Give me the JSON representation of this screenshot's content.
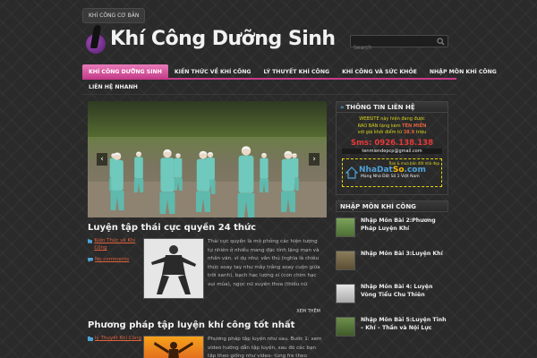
{
  "topbar": {
    "tab_label": "KHÍ CÔNG CƠ BẢN"
  },
  "site": {
    "title": "Khí Công Dưỡng Sinh"
  },
  "search": {
    "placeholder": "Search"
  },
  "nav": {
    "items": [
      {
        "label": "KHÍ CÔNG DƯỠNG SINH"
      },
      {
        "label": "KIẾN THỨC VỀ KHÍ CÔNG"
      },
      {
        "label": "LÝ THUYẾT KHÍ CÔNG"
      },
      {
        "label": "KHÍ CÔNG VÀ SỨC KHỎE"
      },
      {
        "label": "NHẬP MÔN KHÍ CÔNG"
      }
    ],
    "row2": [
      {
        "label": "LIÊN HỆ NHANH"
      }
    ]
  },
  "slider": {
    "prev": "‹",
    "next": "›"
  },
  "posts": [
    {
      "title": "Luyện tập thái cực quyền 24 thức",
      "category": "Kiến Thức về Khí Công",
      "comments": "No comments",
      "excerpt": "Thái cực quyền là mô phỏng các hiện tượng tự nhiên ở nhiều mang đặc tính lặng mạn và nhân văn, ví dụ như: vân thủ (nghĩa là chiêu thức xoay tay như mây trắng xoay cuộn giữa trời xanh), bạch hạc lượng xí (con chim hạc vui múa), ngọc nữ xuyên thoa (thiếu nữ",
      "read_more": "XEM THÊM"
    },
    {
      "title": "Phương pháp tập luyện khí công tốt nhất",
      "category": "lý Thuyết Khí Công",
      "excerpt": "Phương pháp tập luyện như sau. Bước 1: xem video hướng dẫn tập luyện, sau đó các bạn tập theo giống như video- tùng fre theo"
    }
  ],
  "sidebar": {
    "contact": {
      "title": "THÔNG TIN LIÊN HỆ",
      "line1": "WEBSITE này hiện đang được",
      "line2_prefix": "RAO BÁN tặng kèm ",
      "line2_bold": "TÊN MIỀN",
      "line3_prefix": "với giá khởi điểm từ ",
      "line3_bold": "38.9",
      "line3_suffix": " triệu",
      "sms": "Sms: 0926.138.138",
      "email": "tenmiendepcp@gmail.com",
      "nds_top": "Rao & mua bán đất nhà đẹp",
      "nds_logo_main": "NhaDat",
      "nds_logo_accent": "So",
      "nds_logo_tld": ".com",
      "nds_sub": "Mạng Nhà Đất Số 1 Việt Nam"
    },
    "nhap_mon": {
      "title": "NHẬP MÔN KHÍ CÔNG",
      "items": [
        {
          "label": "Nhập Môn Bài 2:Phương Pháp Luyện Khí"
        },
        {
          "label": "Nhập Môn Bài 3:Luyện Khí"
        },
        {
          "label": "Nhập Môn Bài 4: Luyện Vòng Tiểu Chu Thiên"
        },
        {
          "label": "Nhập Môn Bài 5:Luyện Tinh – Khí – Thần và Nội Lực"
        }
      ]
    }
  },
  "colors": {
    "accent_pink": "#c93a8a",
    "link_orange": "#e0623b",
    "info_yellow": "#d9d21f",
    "sms_red": "#e83a3a"
  }
}
